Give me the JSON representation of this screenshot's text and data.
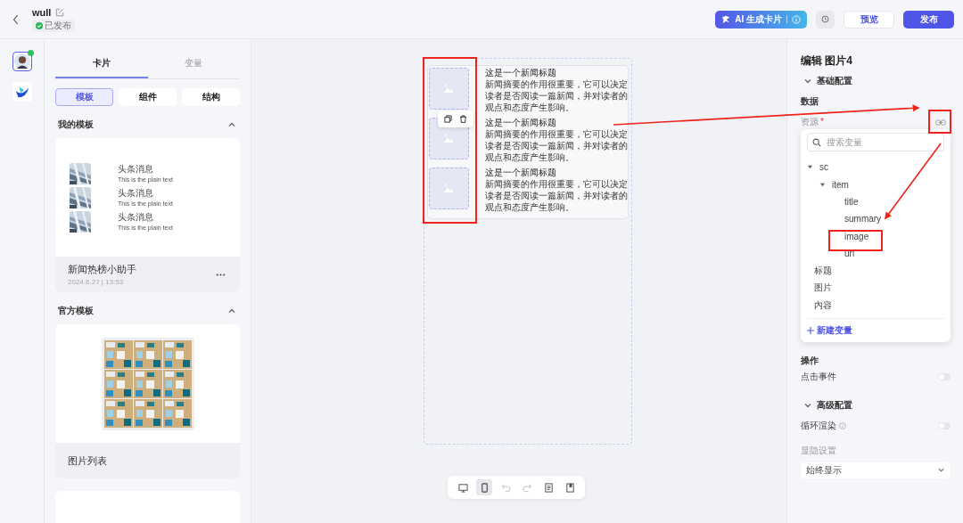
{
  "header": {
    "title": "wull",
    "status": "已发布",
    "buttons": [
      {
        "kind": "ai",
        "label": "AI 生成卡片"
      },
      {
        "kind": "history"
      },
      {
        "kind": "secondary",
        "label": "预览"
      },
      {
        "kind": "primary",
        "label": "发布"
      }
    ]
  },
  "rail": [
    {
      "kind": "avatar",
      "selected": true,
      "online": true
    },
    {
      "kind": "logo",
      "selected": false,
      "online": false
    }
  ],
  "left_panel": {
    "tabs": [
      {
        "label": "卡片",
        "selected": true
      },
      {
        "label": "变量",
        "selected": false
      }
    ],
    "segments": [
      {
        "label": "模板",
        "selected": true
      },
      {
        "label": "组件",
        "selected": false
      },
      {
        "label": "结构",
        "selected": false
      }
    ],
    "sections": [
      {
        "title": "我的模板",
        "expanded": true,
        "templates": [
          {
            "kind": "news",
            "name": "新闻热榜小助手",
            "meta": "2024.6.27 | 13:53",
            "rows": [
              {
                "title": "头条消息",
                "text": "This is the plain text"
              },
              {
                "title": "头条消息",
                "text": "This is the plain text"
              },
              {
                "title": "头条消息",
                "text": "This is the plain text"
              }
            ]
          }
        ]
      },
      {
        "title": "官方模板",
        "expanded": true,
        "templates": [
          {
            "kind": "grid",
            "name": "图片列表"
          },
          {
            "kind": "strip"
          }
        ]
      }
    ]
  },
  "canvas": {
    "items": [
      {
        "title": "这是一个新闻标题",
        "summary": "新闻摘要的作用很重要，它可以决定读者是否阅读一篇新闻，并对读者的观点和态度产生影响。"
      },
      {
        "title": "这是一个新闻标题",
        "summary": "新闻摘要的作用很重要，它可以决定读者是否阅读一篇新闻，并对读者的观点和态度产生影响。"
      },
      {
        "title": "这是一个新闻标题",
        "summary": "新闻摘要的作用很重要，它可以决定读者是否阅读一篇新闻，并对读者的观点和态度产生影响。"
      }
    ],
    "toolbar": [
      {
        "kind": "desktop",
        "selected": false,
        "disabled": false
      },
      {
        "kind": "mobile",
        "selected": true,
        "disabled": false
      },
      {
        "kind": "undo",
        "selected": false,
        "disabled": true
      },
      {
        "kind": "redo",
        "selected": false,
        "disabled": true
      },
      {
        "kind": "document",
        "selected": false,
        "disabled": false
      },
      {
        "kind": "bookmark",
        "selected": false,
        "disabled": false
      }
    ]
  },
  "inspector": {
    "title": "编辑 图片4",
    "basic": {
      "title": "基础配置",
      "expanded": true
    },
    "data_label": "数据",
    "field": {
      "label": "资源",
      "required_mark": "*"
    },
    "popover": {
      "placeholder": "搜索变量",
      "tree": [
        {
          "label": "sc",
          "expanded": true,
          "children": [
            {
              "label": "item",
              "expanded": true,
              "children": [
                {
                  "label": "title"
                },
                {
                  "label": "summary"
                },
                {
                  "label": "image"
                },
                {
                  "label": "url"
                }
              ]
            }
          ]
        },
        {
          "label": "标题"
        },
        {
          "label": "图片"
        },
        {
          "label": "内容"
        }
      ],
      "add": "新建变量"
    },
    "action_label": "操作",
    "click": {
      "label": "点击事件",
      "on": false
    },
    "advanced": {
      "title": "高级配置",
      "expanded": true
    },
    "loop": {
      "label": "循环渲染",
      "on": false
    },
    "visibility": {
      "label": "显隐设置",
      "value": "始终显示"
    }
  }
}
